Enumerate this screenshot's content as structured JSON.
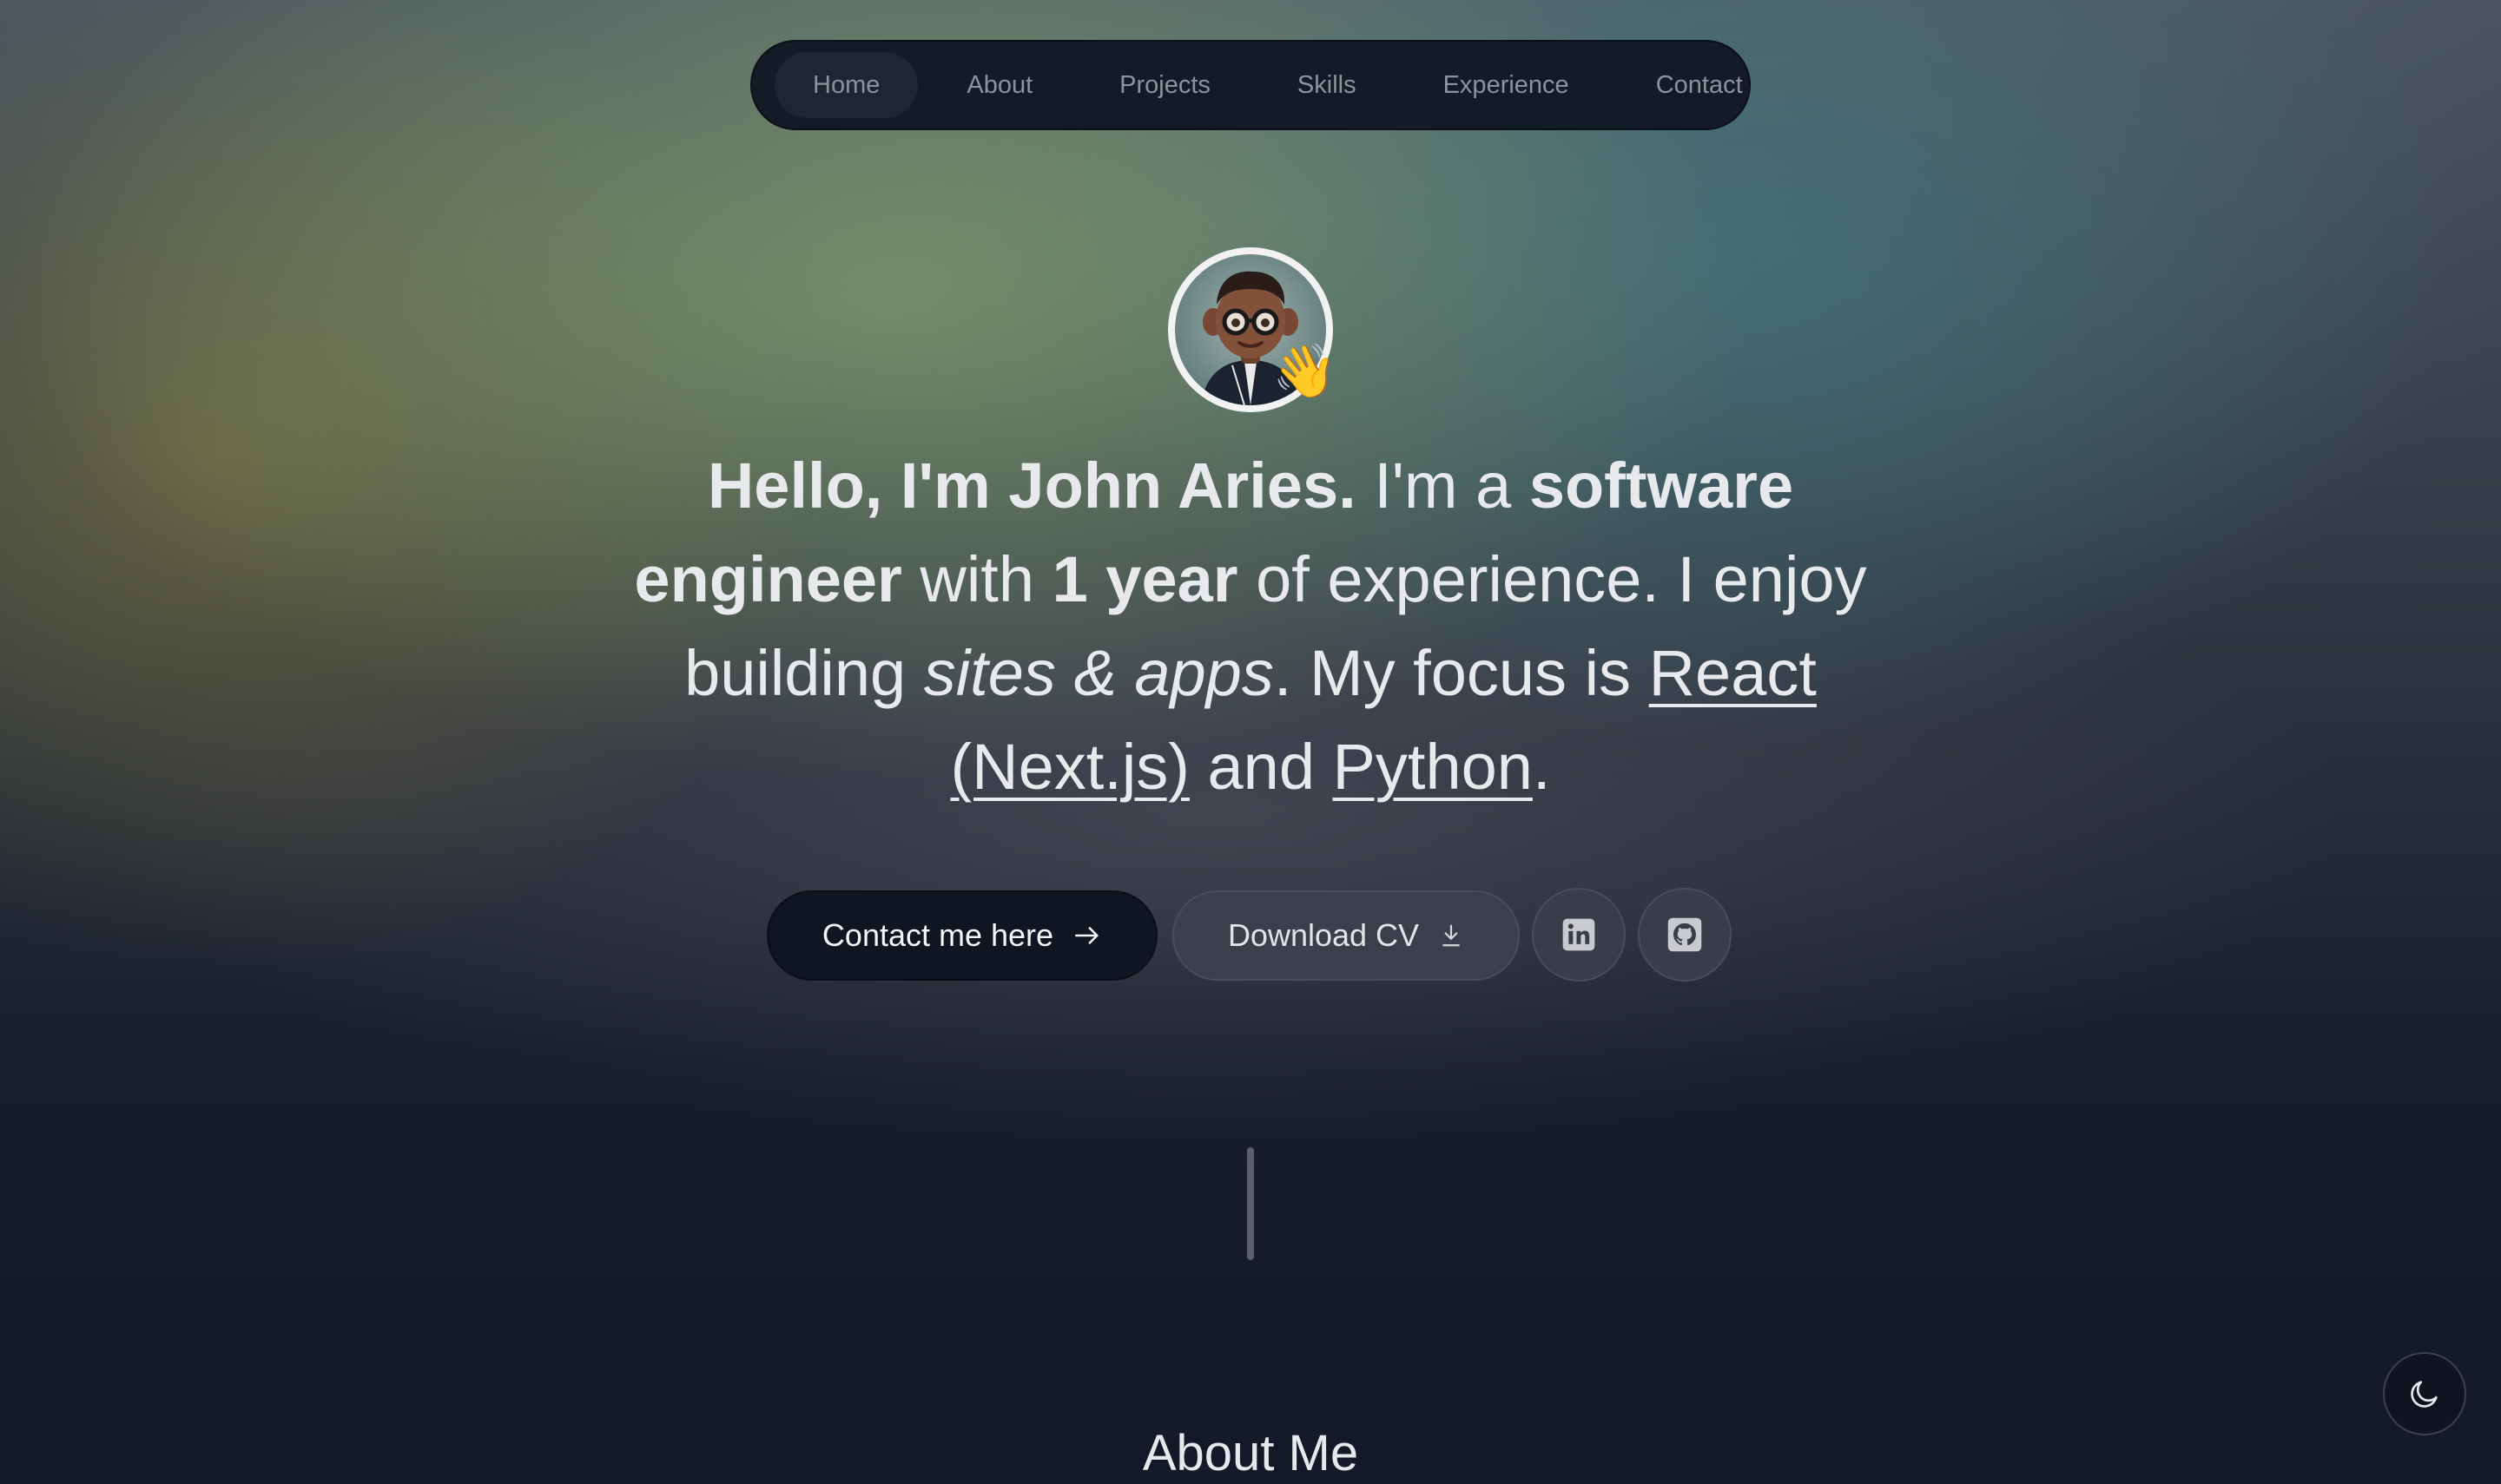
{
  "nav": {
    "items": [
      {
        "label": "Home",
        "active": true
      },
      {
        "label": "About"
      },
      {
        "label": "Projects"
      },
      {
        "label": "Skills"
      },
      {
        "label": "Experience"
      },
      {
        "label": "Contact"
      }
    ]
  },
  "hero": {
    "avatar_icon": "memoji-avatar",
    "wave_emoji": "👋",
    "intro_bold": "Hello, I'm John Aries.",
    "im_a": " I'm a ",
    "role_bold": "software engineer",
    "with": " with ",
    "years_bold": "1 year",
    "of_experience": " of experience. I enjoy building ",
    "sites_italic": "sites & apps",
    "focus": ". My focus is ",
    "react_link": "React (Next.js)",
    "and": " and ",
    "python_link": "Python",
    "period": "."
  },
  "actions": {
    "contact_label": "Contact me here",
    "contact_icon": "arrow-right-icon",
    "cv_label": "Download CV",
    "cv_icon": "download-icon",
    "linkedin_icon": "linkedin-icon",
    "github_icon": "github-icon"
  },
  "about": {
    "title": "About Me"
  },
  "theme": {
    "toggle_icon": "moon-icon"
  },
  "colors": {
    "accent_dark": "#0f1521",
    "secondary_button": "#3b3e4b"
  }
}
